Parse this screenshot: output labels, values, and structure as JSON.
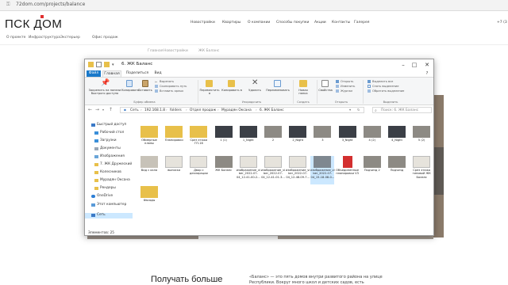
{
  "browser": {
    "url": "72dom.com/projects/balance"
  },
  "site": {
    "logo": "ПСК ДОМ",
    "topnav": [
      "Новостройки",
      "Квартиры",
      "О компании",
      "Способы покупки",
      "Акции",
      "Контакты",
      "Галерея"
    ],
    "phone": "+7 (3",
    "subnav": [
      "О проекте",
      "Инфраструктура",
      "Экстерьер",
      "Офис продаж"
    ],
    "breadcrumb": [
      "Главная",
      "Новостройки",
      "ЖК Баланс"
    ],
    "heading": "Получать больше",
    "text": "«Баланс» — это пять домов внутри развитого района на улице Республики. Вокруг много школ и детских садов, есть"
  },
  "explorer": {
    "title": "6. ЖК Баланс",
    "tabs": [
      "Файл",
      "Главная",
      "Поделиться",
      "Вид"
    ],
    "ribbon": {
      "pin": "Закрепить на панели быстрого доступа",
      "copy": "Копировать",
      "paste": "Вставить",
      "cut": "Вырезать",
      "copy_path": "Скопировать путь",
      "paste_shortcut": "Вставить ярлык",
      "group_clipboard": "Буфер обмена",
      "move_to": "Переместить в",
      "copy_to": "Копировать в",
      "delete": "Удалить",
      "rename": "Переименовать",
      "group_organize": "Упорядочить",
      "new_folder": "Новая папка",
      "group_create": "Создать",
      "properties": "Свойства",
      "open": "Открыть",
      "edit": "Изменить",
      "history": "Журнал",
      "group_open": "Открыть",
      "select_all": "Выделить все",
      "select_none": "Снять выделение",
      "invert": "Обратить выделение",
      "group_select": "Выделить"
    },
    "path": [
      "Сеть",
      "192.168.1.8",
      "folders",
      "Отдел продаж",
      "Мурадян Оксана",
      "6. ЖК Баланс"
    ],
    "search_placeholder": "Поиск: 6. ЖК Баланс",
    "nav": {
      "quick_access": "Быстрый доступ",
      "desktop": "Рабочий стол",
      "downloads": "Загрузки",
      "documents": "Документы",
      "images": "Изображения",
      "druzhba": "7. ЖК Дружеский",
      "kolesnikov": "Колесников",
      "muradyan": "Мурадян Оксана",
      "renders": "Рендеры",
      "onedrive": "OneDrive",
      "this_pc": "Этот компьютер",
      "network": "Сеть"
    },
    "files": [
      {
        "name": "Обмерные планы",
        "kind": "folder"
      },
      {
        "name": "Планировки",
        "kind": "folder"
      },
      {
        "name": "Срез этажа ГП-16",
        "kind": "folder"
      },
      {
        "name": "1 (1)",
        "kind": "photo-dark"
      },
      {
        "name": "1_Night",
        "kind": "photo-dark"
      },
      {
        "name": "2",
        "kind": "photo-gray"
      },
      {
        "name": "2_Night",
        "kind": "photo-dark"
      },
      {
        "name": "3",
        "kind": "photo-gray"
      },
      {
        "name": "3_Night",
        "kind": "photo-dark"
      },
      {
        "name": "4 (2)",
        "kind": "photo-gray"
      },
      {
        "name": "4_Night",
        "kind": "photo-dark"
      },
      {
        "name": "5 (2)",
        "kind": "photo-gray"
      },
      {
        "name": "Вид с окна",
        "kind": "photo-light"
      },
      {
        "name": "выписка",
        "kind": "doc"
      },
      {
        "name": "Двор с декларации",
        "kind": "doc"
      },
      {
        "name": "ЖК Баланс",
        "kind": "photo-gray"
      },
      {
        "name": "изображение_viber_2022-07-04_12-41-00-2...",
        "kind": "doc"
      },
      {
        "name": "изображение_viber_2022-07-04_12-41-01-3...",
        "kind": "doc"
      },
      {
        "name": "изображение_viber_2022-07-04_12-48-09-7...",
        "kind": "doc"
      },
      {
        "name": "изображение_viber_2022-07-04_15-18-08-0...",
        "kind": "photo-sel"
      },
      {
        "name": "Объединенные планировки V3",
        "kind": "pdf"
      },
      {
        "name": "Подъезд 2",
        "kind": "photo-gray"
      },
      {
        "name": "Подъезд",
        "kind": "photo-gray"
      },
      {
        "name": "Срез этажа типовой ЖК Баланс",
        "kind": "doc"
      },
      {
        "name": "Фасады",
        "kind": "folder"
      }
    ],
    "status": "Элементов: 25"
  }
}
